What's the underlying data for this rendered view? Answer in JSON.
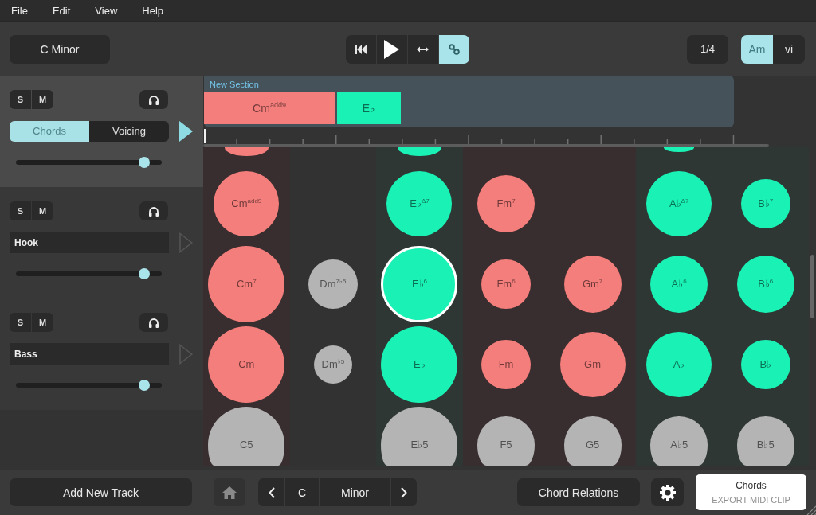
{
  "menu": [
    "File",
    "Edit",
    "View",
    "Help"
  ],
  "toolbar": {
    "key_button": "C Minor",
    "transport": [
      {
        "kind": "skip-back",
        "on": false
      },
      {
        "kind": "play",
        "on": false
      },
      {
        "kind": "arrows",
        "on": false
      },
      {
        "kind": "link",
        "on": true
      }
    ],
    "grid_button": "1/4",
    "name_modes": [
      {
        "label": "Am",
        "selected": true
      },
      {
        "label": "vi",
        "selected": false
      }
    ]
  },
  "tracks": [
    {
      "kind": "chords",
      "selected": true,
      "armed": true,
      "buttons": [
        {
          "label": "S",
          "on": false
        },
        {
          "label": "M",
          "on": false
        }
      ],
      "tabs": [
        {
          "label": "Chords",
          "selected": true
        },
        {
          "label": "Voicing",
          "selected": false
        }
      ],
      "level": 0.88
    },
    {
      "kind": "instrument",
      "selected": false,
      "armed": false,
      "buttons": [
        {
          "label": "S",
          "on": false
        },
        {
          "label": "M",
          "on": false
        }
      ],
      "name": "Hook",
      "level": 0.88
    },
    {
      "kind": "instrument",
      "selected": false,
      "armed": false,
      "buttons": [
        {
          "label": "S",
          "on": false
        },
        {
          "label": "M",
          "on": false
        }
      ],
      "name": "Bass",
      "level": 0.88
    }
  ],
  "add_track_button": "Add New Track",
  "section": {
    "title": "New Section",
    "blocks": [
      {
        "kind": "whole",
        "label": "Cm$^{add9}$",
        "color": "#f47e7c"
      },
      {
        "kind": "half",
        "label": "E♭",
        "color": "#1af2b5"
      }
    ]
  },
  "grid": {
    "columns": [
      {
        "color": "#392e2f",
        "chords": [
          {
            "kind": "large",
            "color": "#f47e7c",
            "selected": false
          },
          {
            "kind": "large",
            "label": "Cm$^{add9}$",
            "color": "#f47e7c",
            "selected": false
          },
          {
            "kind": "huge",
            "label": "Cm$^{7}$",
            "color": "#f47e7c",
            "selected": false
          },
          {
            "kind": "huge",
            "label": "Cm",
            "color": "#f47e7c",
            "selected": false
          },
          {
            "kind": "huge",
            "label": "C5",
            "color": "#b4b4b4",
            "selected": false
          }
        ]
      },
      {
        "color": "#323232",
        "chords": [
          {
            "kind": "gap"
          },
          {
            "kind": "gap"
          },
          {
            "kind": "small",
            "label": "Dm$^{7♭5}$",
            "color": "#b4b4b4",
            "selected": false
          },
          {
            "kind": "tiny",
            "label": "Dm$^{♭5}$",
            "color": "#b4b4b4",
            "selected": false
          },
          {
            "kind": "gap"
          }
        ]
      },
      {
        "color": "#2e3734",
        "chords": [
          {
            "kind": "large",
            "color": "#1af2b5",
            "selected": false
          },
          {
            "kind": "large",
            "label": "E♭$^{Δ7}$",
            "color": "#1af2b5",
            "selected": false
          },
          {
            "kind": "huge",
            "label": "E♭$^{6}$",
            "color": "#1af2b5",
            "selected": true
          },
          {
            "kind": "huge",
            "label": "E♭",
            "color": "#1af2b5",
            "selected": false
          },
          {
            "kind": "huge",
            "label": "E♭5",
            "color": "#b4b4b4",
            "selected": false
          }
        ]
      },
      {
        "color": "#392e2f",
        "chords": [
          {
            "kind": "gap"
          },
          {
            "kind": "medium",
            "label": "Fm$^{7}$",
            "color": "#f47e7c",
            "selected": false
          },
          {
            "kind": "small",
            "label": "Fm$^{6}$",
            "color": "#f47e7c",
            "selected": false
          },
          {
            "kind": "small",
            "label": "Fm",
            "color": "#f47e7c",
            "selected": false
          },
          {
            "kind": "medium",
            "label": "F5",
            "color": "#b4b4b4",
            "selected": false
          }
        ]
      },
      {
        "color": "#392e2f",
        "chords": [
          {
            "kind": "gap"
          },
          {
            "kind": "gap"
          },
          {
            "kind": "medium",
            "label": "Gm$^{7}$",
            "color": "#f47e7c",
            "selected": false
          },
          {
            "kind": "large",
            "label": "Gm",
            "color": "#f47e7c",
            "selected": false
          },
          {
            "kind": "medium",
            "label": "G5",
            "color": "#b4b4b4",
            "selected": false
          }
        ]
      },
      {
        "color": "#2e3734",
        "chords": [
          {
            "kind": "medium",
            "color": "#1af2b5",
            "selected": false
          },
          {
            "kind": "large",
            "label": "A♭$^{Δ7}$",
            "color": "#1af2b5",
            "selected": false
          },
          {
            "kind": "medium",
            "label": "A♭$^{6}$",
            "color": "#1af2b5",
            "selected": false
          },
          {
            "kind": "large",
            "label": "A♭",
            "color": "#1af2b5",
            "selected": false
          },
          {
            "kind": "medium",
            "label": "A♭5",
            "color": "#b4b4b4",
            "selected": false
          }
        ]
      },
      {
        "color": "#2e3734",
        "chords": [
          {
            "kind": "gap"
          },
          {
            "kind": "small",
            "label": "B♭$^{7}$",
            "color": "#1af2b5",
            "selected": false
          },
          {
            "kind": "medium",
            "label": "B♭$^{6}$",
            "color": "#1af2b5",
            "selected": false
          },
          {
            "kind": "small",
            "label": "B♭",
            "color": "#1af2b5",
            "selected": false
          },
          {
            "kind": "medium",
            "label": "B♭5",
            "color": "#b4b4b4",
            "selected": false
          }
        ]
      }
    ]
  },
  "bottom_bar": {
    "key_root": "C",
    "key_mode": "Minor",
    "relations_button": "Chord Relations",
    "export": {
      "title": "Chords",
      "hint": "EXPORT MIDI CLIP"
    }
  }
}
